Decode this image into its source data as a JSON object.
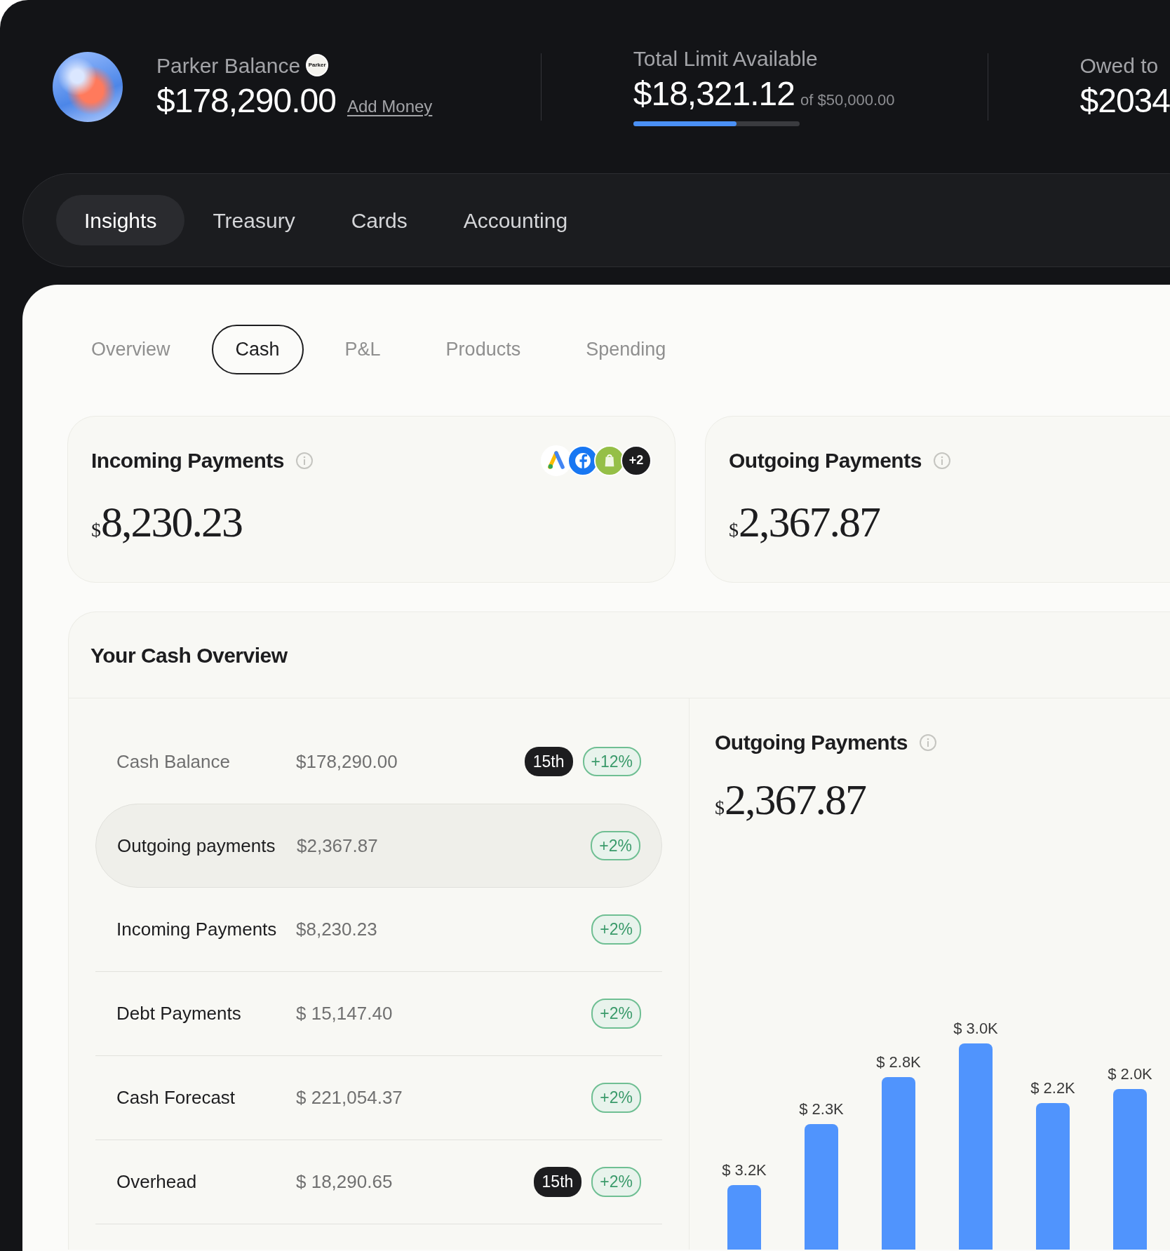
{
  "header": {
    "balance": {
      "label": "Parker Balance",
      "logo_text": "Parker",
      "amount": "$178,290.00",
      "link": "Add Money"
    },
    "limit": {
      "label": "Total Limit Available",
      "amount": "$18,321.12",
      "of": "of $50,000.00",
      "level": 0.62
    },
    "owed": {
      "label": "Owed to",
      "amount": "$2034"
    }
  },
  "main_tabs": [
    {
      "label": "Insights",
      "selected": true
    },
    {
      "label": "Treasury",
      "selected": false
    },
    {
      "label": "Cards",
      "selected": false
    },
    {
      "label": "Accounting",
      "selected": false
    }
  ],
  "sub_tabs": [
    {
      "label": "Overview",
      "selected": false
    },
    {
      "label": "Cash",
      "selected": true
    },
    {
      "label": "P&L",
      "selected": false
    },
    {
      "label": "Products",
      "selected": false
    },
    {
      "label": "Spending",
      "selected": false
    }
  ],
  "summary_cards": [
    {
      "title": "Incoming Payments",
      "currency": "$",
      "amount": "8,230.23",
      "sources_more": "+2"
    },
    {
      "title": "Outgoing Payments",
      "currency": "$",
      "amount": "2,367.87"
    }
  ],
  "cash_overview": {
    "title": "Your Cash Overview",
    "rows": [
      {
        "label": "Cash Balance",
        "value": "$178,290.00",
        "date": "15th",
        "change": "+12%",
        "selected": false
      },
      {
        "label": "Outgoing payments",
        "value": "$2,367.87",
        "change": "+2%",
        "selected": true
      },
      {
        "label": "Incoming Payments",
        "value": "$8,230.23",
        "change": "+2%",
        "selected": false
      },
      {
        "label": "Debt Payments",
        "value": "$ 15,147.40",
        "change": "+2%",
        "selected": false
      },
      {
        "label": "Cash Forecast",
        "value": "$ 221,054.37",
        "change": "+2%",
        "selected": false
      },
      {
        "label": "Overhead",
        "value": "$ 18,290.65",
        "date": "15th",
        "change": "+2%",
        "selected": false
      }
    ],
    "detail": {
      "title": "Outgoing Payments",
      "currency": "$",
      "amount": "2,367.87",
      "bar_labels": [
        "$ 3.2K",
        "$ 2.3K",
        "$ 2.8K",
        "$ 3.0K",
        "$ 2.2K",
        "$ 2.0K"
      ]
    }
  }
}
